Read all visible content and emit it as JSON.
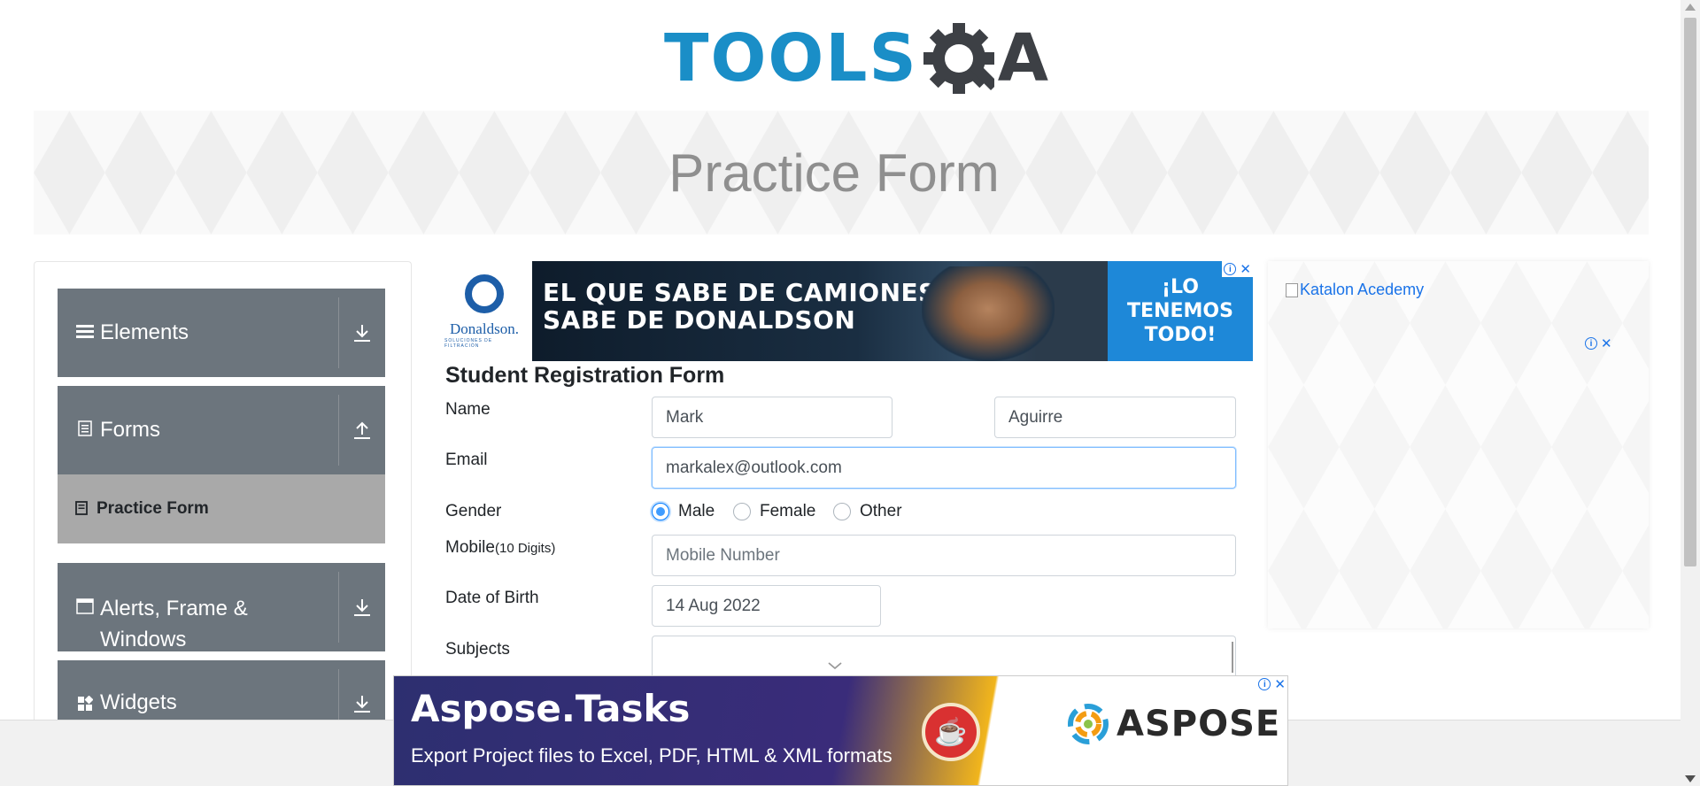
{
  "header": {
    "logo_tools": "TOOLS",
    "logo_qa": "A",
    "banner_title": "Practice Form"
  },
  "sidebar": {
    "groups": [
      {
        "label": "Elements",
        "icon": "hamburger-icon",
        "arrow": "download-arrow-icon"
      },
      {
        "label": "Forms",
        "icon": "document-icon",
        "arrow": "upload-arrow-icon"
      },
      {
        "label": "Alerts, Frame & Windows",
        "label_line1": "Alerts, Frame &",
        "label_line2": "Windows",
        "icon": "window-icon",
        "arrow": "download-arrow-icon"
      },
      {
        "label": "Widgets",
        "icon": "widgets-icon",
        "arrow": "download-arrow-icon"
      }
    ],
    "active_item": {
      "label": "Practice Form",
      "icon": "form-icon"
    }
  },
  "ads": {
    "top": {
      "brand": "Donaldson.",
      "brand_sub": "SOLUCIONES DE FILTRACIÓN",
      "headline_line1": "EL QUE SABE DE CAMIONES",
      "headline_line2": "SABE DE DONALDSON",
      "cta_line1": "¡LO",
      "cta_line2": "TENEMOS",
      "cta_line3": "TODO!"
    },
    "side": {
      "alt_text": "Katalon Acedemy"
    },
    "bottom": {
      "title": "Aspose.Tasks",
      "subtitle": "Export Project files to Excel, PDF, HTML & XML formats",
      "brand": "ASPOSE"
    }
  },
  "form": {
    "title": "Student Registration Form",
    "name_label": "Name",
    "first_name": "Mark",
    "last_name": "Aguirre",
    "email_label": "Email",
    "email_value": "markalex@outlook.com",
    "gender_label": "Gender",
    "gender_options": [
      "Male",
      "Female",
      "Other"
    ],
    "gender_selected": "Male",
    "mobile_label": "Mobile",
    "mobile_hint": "(10 Digits)",
    "mobile_placeholder": "Mobile Number",
    "dob_label": "Date of Birth",
    "dob_value": "14 Aug 2022",
    "subjects_label": "Subjects",
    "subjects_value": ""
  },
  "colors": {
    "brand_blue": "#1a8ec7",
    "sidebar_group": "#6c757d",
    "sidebar_active": "#a9a9a9",
    "focus_border": "#80bdff"
  }
}
